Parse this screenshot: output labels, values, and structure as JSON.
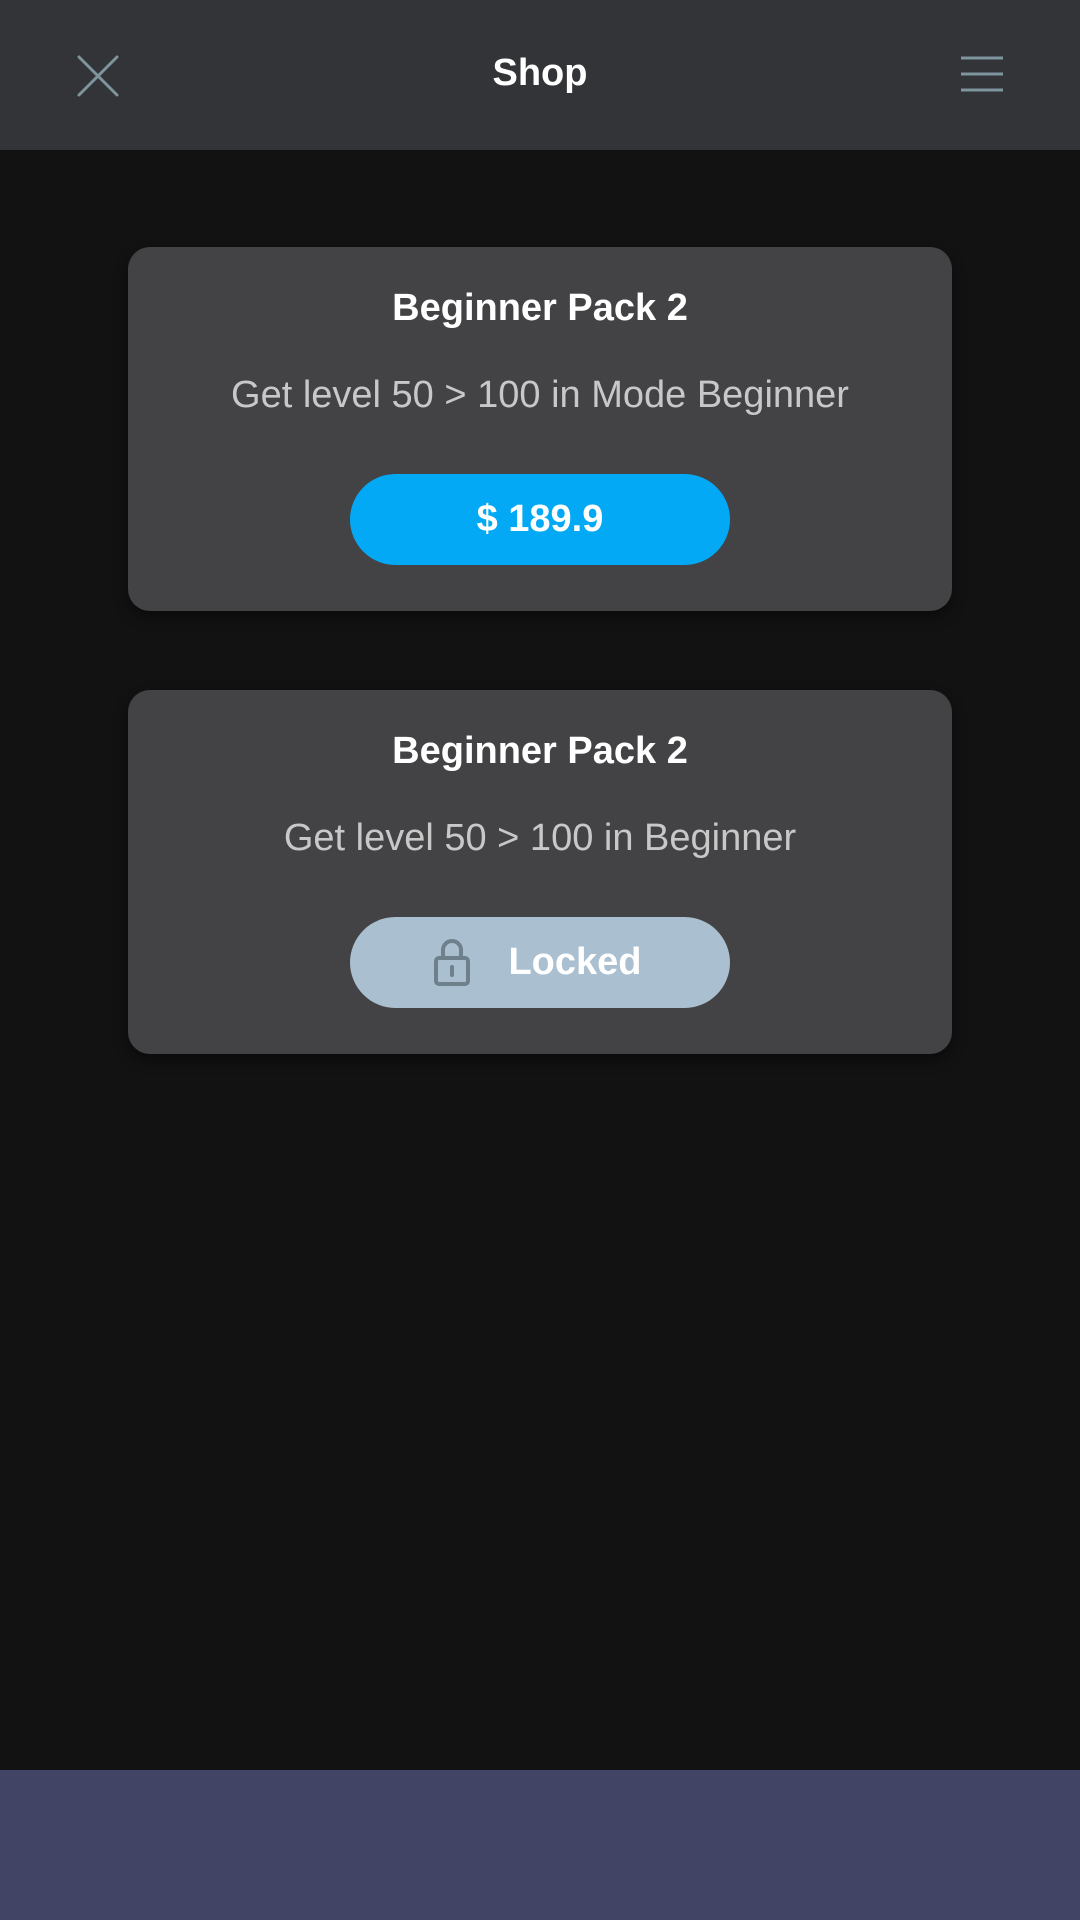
{
  "header": {
    "title": "Shop",
    "close_icon": "close-icon",
    "menu_icon": "hamburger-menu-icon"
  },
  "cards": [
    {
      "title": "Beginner Pack 2",
      "description": "Get level 50 > 100 in Mode Beginner",
      "button_label": "$ 189.9",
      "button_color": "#03a9f4"
    },
    {
      "title": "Beginner Pack 2",
      "description": "Get level 50 > 100 in Beginner",
      "button_label": "Locked",
      "button_icon": "lock-icon",
      "button_color": "#aabfcf"
    }
  ],
  "colors": {
    "background": "#121212",
    "header": "#333438",
    "card": "#434346",
    "bottom_bar": "#414465",
    "icon_stroke": "#7e959e"
  }
}
